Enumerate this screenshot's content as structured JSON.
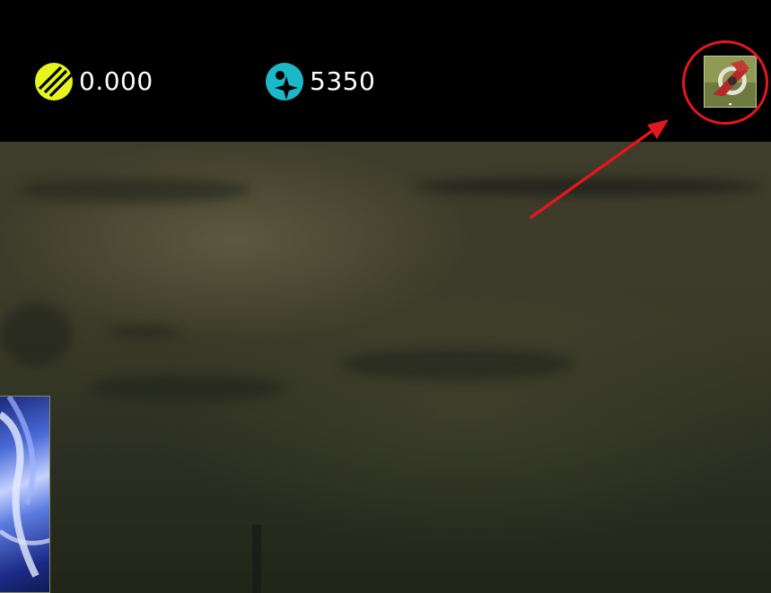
{
  "topbar": {
    "energy": {
      "value": "0.000",
      "icon": "energy-stripes-icon",
      "color": "#e6f51c"
    },
    "gems": {
      "value": "5350",
      "icon": "star-drop-icon",
      "color": "#1cb7c9"
    },
    "avatar": {
      "icon": "player-avatar-icon"
    }
  },
  "annotation": {
    "color": "#e3171c",
    "shape": "circle-with-arrow"
  }
}
